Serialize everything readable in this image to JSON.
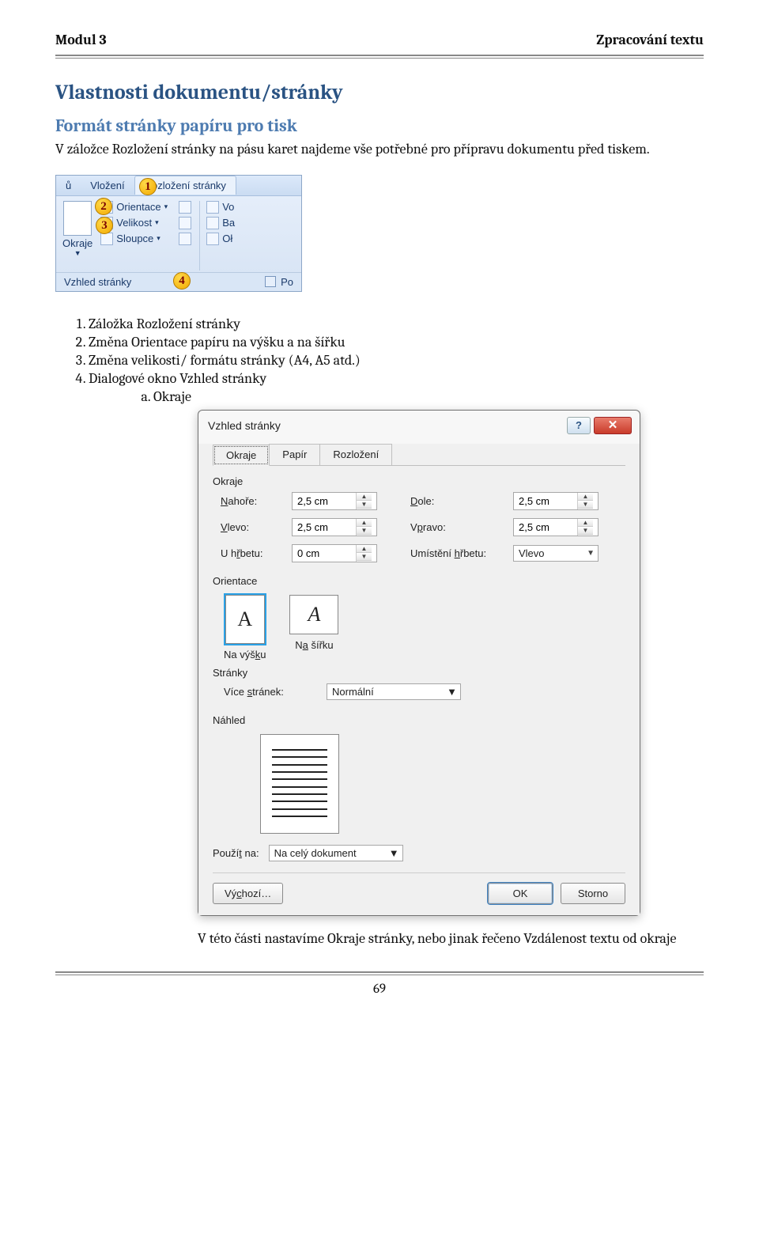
{
  "header": {
    "left": "Modul 3",
    "right": "Zpracování textu"
  },
  "h1": "Vlastnosti dokumentu/stránky",
  "h2": "Formát stránky papíru pro tisk",
  "intro": "V záložce Rozložení stránky na pásu karet najdeme vše potřebné pro přípravu dokumentu před tiskem.",
  "ribbon": {
    "tabs": {
      "t1": "ů",
      "t2": "Vložení",
      "t3": "Rozložení stránky"
    },
    "okraje": "Okraje",
    "items": {
      "orientace": "Orientace",
      "velikost": "Velikost",
      "sloupce": "Sloupce"
    },
    "right_letters": {
      "a": "Vo",
      "b": "Ba",
      "c": "Oł"
    },
    "footer": {
      "label": "Vzhled stránky",
      "right": "Po"
    },
    "markers": {
      "m1": "1",
      "m2": "2",
      "m3": "3",
      "m4": "4"
    }
  },
  "list": {
    "i1": "Záložka Rozložení stránky",
    "i2": "Změna Orientace papíru na výšku a na šířku",
    "i3": "Změna velikosti/ formátu stránky (A4, A5 atd.)",
    "i4": "Dialogové okno Vzhled stránky",
    "i4a": "Okraje"
  },
  "dialog": {
    "title": "Vzhled stránky",
    "help": "?",
    "close": "✕",
    "tabs": {
      "t1": "Okraje",
      "t2": "Papír",
      "t3": "Rozložení"
    },
    "group_margins": "Okraje",
    "labels": {
      "top": "Nahoře:",
      "bottom": "Dole:",
      "left": "Vlevo:",
      "right": "Vpravo:",
      "gutter": "U hřbetu:",
      "gutter_pos": "Umístění hřbetu:"
    },
    "underlines": {
      "top": "N",
      "bottom": "D",
      "left": "V",
      "right": "p",
      "gutter": "ř",
      "gutter_pos": "h"
    },
    "values": {
      "top": "2,5 cm",
      "bottom": "2,5 cm",
      "left": "2,5 cm",
      "right": "2,5 cm",
      "gutter": "0 cm",
      "gutter_pos": "Vlevo"
    },
    "group_orient": "Orientace",
    "orient": {
      "portrait": "Na výšku",
      "landscape": "Na šířku",
      "glyph": "A"
    },
    "group_pages": "Stránky",
    "pages": {
      "label": "Více stránek:",
      "value": "Normální"
    },
    "group_preview": "Náhled",
    "apply": {
      "label": "Použít na:",
      "value": "Na celý dokument"
    },
    "footer": {
      "default": "Výchozí…",
      "ok": "OK",
      "cancel": "Storno"
    }
  },
  "closing": "V této části nastavíme Okraje stránky, nebo jinak řečeno Vzdálenost textu od okraje",
  "page_num": "69"
}
